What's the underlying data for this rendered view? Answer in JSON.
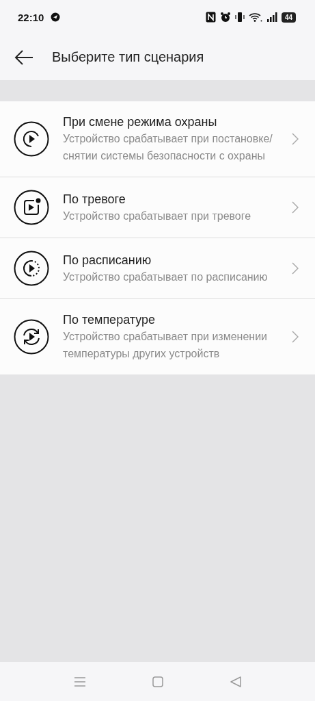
{
  "status_bar": {
    "time": "22:10",
    "battery": "44"
  },
  "header": {
    "title": "Выберите тип сценария"
  },
  "scenarios": [
    {
      "kind": "armed",
      "title": "При смене режима охраны",
      "description": "Устройство срабатывает при постановке/снятии системы безопасности с охраны"
    },
    {
      "kind": "alarm",
      "title": "По тревоге",
      "description": "Устройство срабатывает при тревоге"
    },
    {
      "kind": "schedule",
      "title": "По расписанию",
      "description": "Устройство срабатывает по расписанию"
    },
    {
      "kind": "temperature",
      "title": "По температуре",
      "description": "Устройство срабатывает при изменении температуры других устройств"
    }
  ]
}
